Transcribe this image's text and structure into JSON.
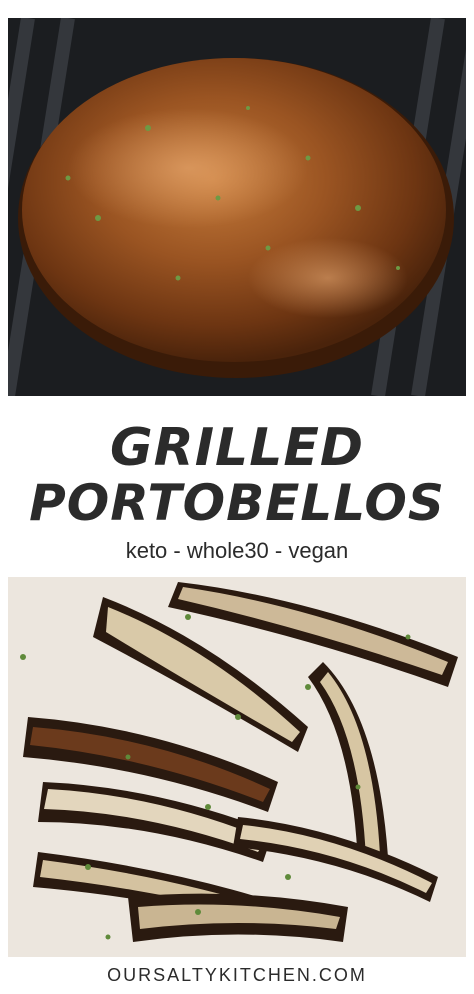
{
  "title": {
    "line1": "GRILLED",
    "line2": "PORTOBELLOS"
  },
  "tagline": "keto - whole30 - vegan",
  "footer": {
    "site": "OURSALTYKITCHEN.COM"
  },
  "colors": {
    "text": "#2b2b2b",
    "grill": "#1b1d20",
    "mushroom": "#8a4a1e",
    "plate": "#ece6de",
    "herb": "#5f8a3a"
  }
}
